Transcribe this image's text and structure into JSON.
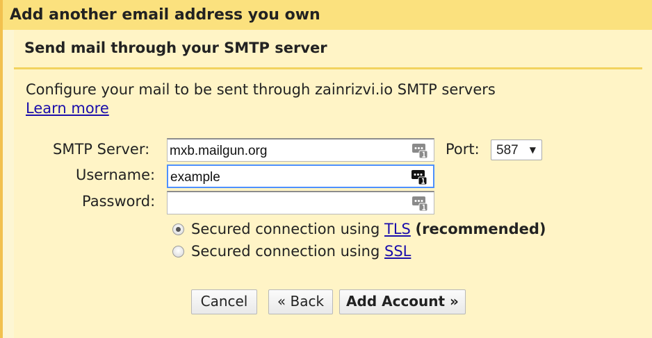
{
  "dialog": {
    "title": "Add another email address you own"
  },
  "section": {
    "title": "Send mail through your SMTP server",
    "description": "Configure your mail to be sent through zainrizvi.io SMTP servers",
    "learn_more": "Learn more"
  },
  "form": {
    "smtp_server": {
      "label": "SMTP Server:",
      "value": "mxb.mailgun.org"
    },
    "username": {
      "label": "Username:",
      "value": "example"
    },
    "password": {
      "label": "Password:",
      "value": ""
    },
    "port": {
      "label": "Port:",
      "value": "587",
      "arrow": "▼"
    }
  },
  "security": {
    "tls": {
      "prefix": "Secured connection using",
      "link": "TLS",
      "suffix": "(recommended)",
      "selected": true
    },
    "ssl": {
      "prefix": "Secured connection using",
      "link": "SSL",
      "selected": false
    }
  },
  "buttons": {
    "cancel": "Cancel",
    "back": "« Back",
    "add_account": "Add Account »"
  },
  "icons": {
    "password_manager": "password-manager-icon"
  },
  "colors": {
    "title_bar": "#fbe17e",
    "panel": "#fff4c6",
    "link": "#1a0dab",
    "focus": "#4d90fe"
  }
}
